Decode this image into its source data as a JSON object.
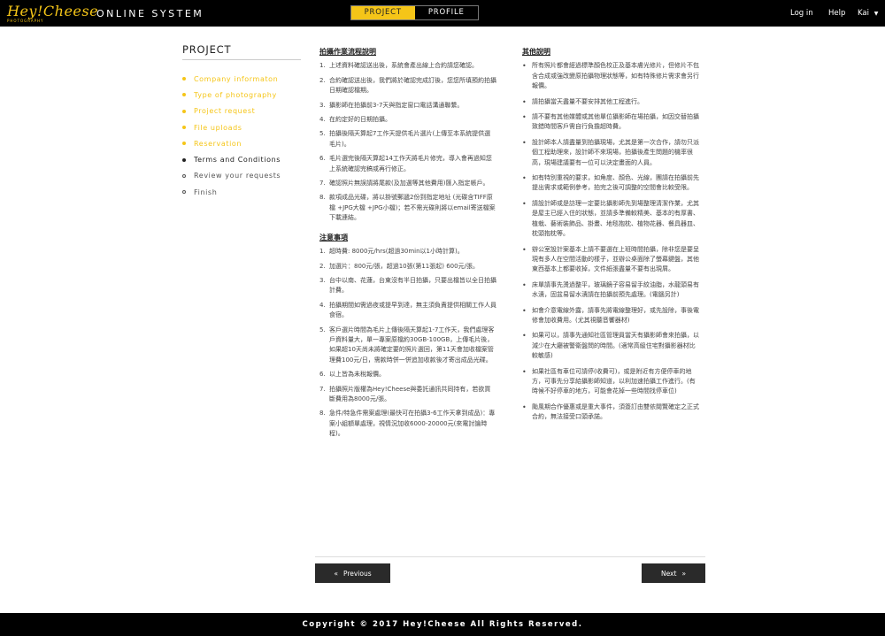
{
  "header": {
    "logo_text": "Hey!Cheese",
    "logo_sub": "PHOTOGRAPHY",
    "system_name": "ONLINE SYSTEM",
    "tabs": [
      {
        "label": "PROJECT",
        "active": true
      },
      {
        "label": "PROFILE",
        "active": false
      }
    ],
    "nav": {
      "login": "Log in",
      "help": "Help",
      "user": "Kai"
    }
  },
  "sidebar": {
    "title": "PROJECT",
    "steps": [
      {
        "label": "Company informaton",
        "state": "done"
      },
      {
        "label": "Type of photography",
        "state": "done"
      },
      {
        "label": "Project request",
        "state": "done"
      },
      {
        "label": "File uploads",
        "state": "done"
      },
      {
        "label": "Reservation",
        "state": "done"
      },
      {
        "label": "Terms and Conditions",
        "state": "current"
      },
      {
        "label": "Review your requests",
        "state": "todo"
      },
      {
        "label": "Finish",
        "state": "todo"
      }
    ]
  },
  "terms": {
    "process_title": "拍攝作業流程說明",
    "process_items": [
      "上述資料確認送出後，系統會產出線上合約請您確認。",
      "合約確認送出後，我們將於確認完成訂後，您您所填預約拍攝日期確認檔期。",
      "攝影師在拍攝前3-7天與指定窗口電話溝通聯繫。",
      "在約定好的日期拍攝。",
      "拍攝後隔天算起7工作天提供毛片選片(上傳至本系統提供選毛片)。",
      "毛片選完後隔天算起14工作天將毛片修完，導入會再過知您 上系統確認完稿或再行修正。",
      "確認照片無誤請將尾款(及加選等其他費用)匯入指定帳戶。",
      "款項成品光碟，將以掛號郵遞2份到指定地址 (光碟含TIFF原檔 +JPG大檔 +JPG小檔)；若不需光碟則將以email寄送檔案下載連結。"
    ],
    "notes_title": "注意事項",
    "notes_items": [
      "超時費: 8000元/hrs(超過30min以1小時計算)。",
      "加選片：800元/張，超過10張(第11張起) 600元/張。",
      "台中以南、花蓮，台東沒有半日拍攝，只要出檔皆以全日拍攝計費。",
      "拍攝期間如需過夜或提早到達，無主須負責提供相關工作人員食宿。",
      "客戶選片時間為毛片上傳後隔天算起1-7工作天，我們處理客戶資料量大，單一專案原檔約30GB-100GB，上傳毛片後，如果超10天尚未將確定要的照片選回，第11天會加收檔案管理費100元/日，需款時併一併追加收款後才寄出成品光碟。",
      "以上皆為未稅報價。",
      "拍攝照片版權為Hey!Cheese與委託通訊共同持有，若欲買斷費用為8000元/張。",
      "急件/特急件需案處理(最快可在拍攝3-6工作天拿到成品)：專案小組額單處理，視情況加收6000-20000元(來電討論時程)。"
    ],
    "other_title": "其他說明",
    "other_items": [
      "所有照片都會經過標準顏色校正及基本膚光修片，但修片不包含合成或強改變原拍攝物理狀態等，如有特殊修片需求會另行報價。",
      "請拍攝當天盡量不要安排其他工程進行。",
      "請不要有其他媒體或其他單位攝影師在場拍攝，如因交替拍攝致錯時間客戶需自行負擔超時費。",
      "設計師本人請盡量到拍攝現場，尤其是第一次合作，請勿只派個工程助理來，設計師不來現場，拍攝後產生問題的機率很高，現場建議要有一位可以決定畫面的人員。",
      "如有特別重視的要求，如角度、顏色、光線，團請在拍攝前先提出需求或範例參考，拍完之後可調整的空間會比較受限。",
      "請設計師或是訪理一定要比攝影師先到場整理清潔作業，尤其是屋主已經入住的狀態，並請多準備較精美、基本的有厚書、植栽、藝術裝飾品、掛畫、地毯抱枕、植物花器、餐具器皿、枕頭抱枕等。",
      "辦公室設計案基本上請不要選在上班時間拍攝，除非您是要呈現有多人在空間活動的樣子，並辦公桌面除了螢幕鍵盤，其他東西基本上都要收掉，文件紙張盡量不要有出現屑。",
      "床單請事先燙過整平，玻璃鏡子容易留手紋油脂，水龍頭易有水漬，固盆易留水漬請在拍攝前預先處理。(電腦另計)",
      "如會介意電線外露，請事先將電線整理好，或先設除，事後電修會加收費用。(尤其視聽音響器材)",
      "如果可以，請事先通知社區管理員當天有攝影師會來拍攝，以減少在大廳被警衛盤問的時間。(適常高級住宅對攝影器材比較敏感)",
      "如果社區有車位可請停(收費可)，或是附近有方便停車的地方，可事先分享給攝影師知道，以利加速拍攝工作進行。(有時候不好停車的地方，可能會花掉一些時間找停車位)",
      "颱風期合作優惠或是重大事件，須簽訂由雙依閱覽確定之正式合約，無法接受口頭承諾。"
    ]
  },
  "nav_buttons": {
    "previous": "Previous",
    "next": "Next"
  },
  "footer": {
    "copyright": "Copyright © 2017 Hey!Cheese All Rights Reserved."
  },
  "colors": {
    "accent": "#f5c518",
    "bar": "#000000",
    "button": "#2a2a2a"
  }
}
